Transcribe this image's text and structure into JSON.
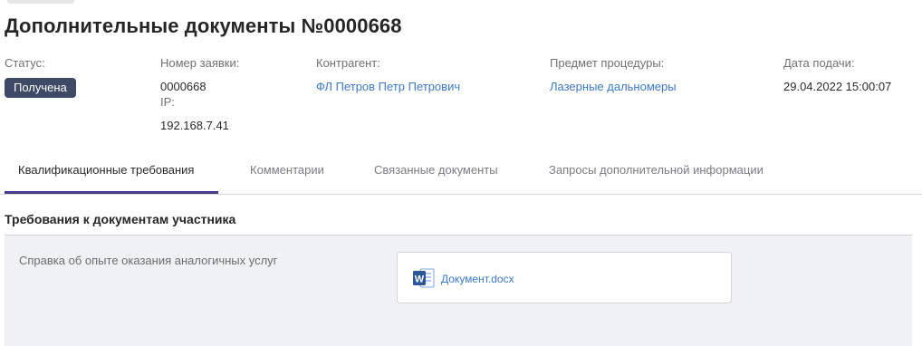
{
  "page": {
    "title": "Дополнительные документы №0000668"
  },
  "meta": {
    "status": {
      "label": "Статус:",
      "value": "Получена"
    },
    "application_number": {
      "label": "Номер заявки:",
      "value": "0000668",
      "ip_label": "IP:",
      "ip_value": "192.168.7.41"
    },
    "counterparty": {
      "label": "Контрагент:",
      "value": "ФЛ Петров Петр Петрович"
    },
    "procedure_subject": {
      "label": "Предмет процедуры:",
      "value": "Лазерные дальномеры"
    },
    "submission_date": {
      "label": "Дата подачи:",
      "value": "29.04.2022 15:00:07"
    }
  },
  "tabs": [
    {
      "label": "Квалификационные требования",
      "active": true
    },
    {
      "label": "Комментарии",
      "active": false
    },
    {
      "label": "Связанные документы",
      "active": false
    },
    {
      "label": "Запросы дополнительной информации",
      "active": false
    }
  ],
  "section": {
    "title": "Требования к документам участника"
  },
  "requirements": [
    {
      "label": "Справка об опыте оказания аналогичных услуг",
      "document": {
        "name": "Документ.docx",
        "icon": "word-document-icon"
      }
    }
  ],
  "colors": {
    "status_badge": "#3e4a66",
    "link": "#3d79c6",
    "tab_underline": "#4a3a8c",
    "panel_bg": "#f0f1f3",
    "word_blue": "#2b5797"
  }
}
